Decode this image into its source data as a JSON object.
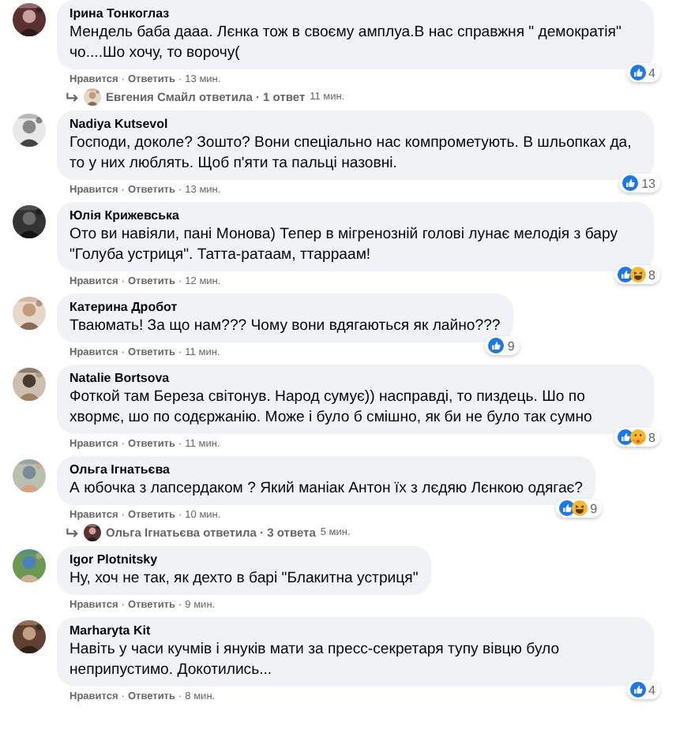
{
  "separator": "·",
  "comments": [
    {
      "author": "Ірина Тонкоглаз",
      "text": "Мендель баба дааа. Лєнка тож в своєму амплуа.В нас справжня \" демократія\" чо....Шо хочу, то ворочу(",
      "like": "Нравится",
      "reply": "Ответить",
      "time": "13 мин.",
      "reactions": [
        {
          "kind": "like"
        }
      ],
      "count": "4",
      "replies": {
        "label": "Евгения Смайл ответила · 1 ответ",
        "time": "11 мин."
      }
    },
    {
      "author": "Nadiya Kutsevol",
      "text": "Господи, доколе? Зошто? Вони спеціально нас компрометують. В шльопках да, то у них люблять. Щоб п'яти та пальці назовні.",
      "like": "Нравится",
      "reply": "Ответить",
      "time": "13 мин.",
      "reactions": [
        {
          "kind": "like"
        }
      ],
      "count": "13"
    },
    {
      "author": "Юлія Крижевська",
      "text": "Ото ви навіяли, пані Монова) Тепер в мігренозній голові лунає мелодія з бару \"Голуба устриця\". Татта-ратаам, ттарраам!",
      "like": "Нравится",
      "reply": "Ответить",
      "time": "12 мин.",
      "reactions": [
        {
          "kind": "like"
        },
        {
          "kind": "haha"
        }
      ],
      "count": "8"
    },
    {
      "author": "Катерина Дробот",
      "text": "Тваюмать! За що нам??? Чому вони вдягаються як лайно???",
      "like": "Нравится",
      "reply": "Ответить",
      "time": "11 мин.",
      "reactions": [
        {
          "kind": "like"
        }
      ],
      "count": "9"
    },
    {
      "author": "Natalie Bortsova",
      "text": "Фоткой там Береза світонув. Народ сумує)) насправді, то пиздець. Шо по хвормє, шо по содєржанію. Може і було б смішно, як би не було так сумно",
      "like": "Нравится",
      "reply": "Ответить",
      "time": "11 мин.",
      "reactions": [
        {
          "kind": "like"
        },
        {
          "kind": "care"
        }
      ],
      "count": "8"
    },
    {
      "author": "Ольга Ігнатьєва",
      "text": "А юбочка з лапсердаком ? Який маніак Антон їх з лєдяю Лєнкою одягає?",
      "like": "Нравится",
      "reply": "Ответить",
      "time": "10 мин.",
      "reactions": [
        {
          "kind": "like"
        },
        {
          "kind": "haha"
        }
      ],
      "count": "9",
      "replies": {
        "label": "Ольга Ігнатьєва ответила · 3 ответа",
        "time": "5 мин."
      }
    },
    {
      "author": "Igor Plotnitsky",
      "text": "Ну, хоч не так, як дехто в барі \"Блакитна устриця\"",
      "like": "Нравится",
      "reply": "Ответить",
      "time": "9 мин."
    },
    {
      "author": "Marharyta Kit",
      "text": "Навіть у часи кучмів і януків мати за пресс-секретаря тупу вівцю було неприпустимо. Докотились...",
      "like": "Нравится",
      "reply": "Ответить",
      "time": "8 мин.",
      "reactions": [
        {
          "kind": "like"
        }
      ],
      "count": "4"
    }
  ]
}
